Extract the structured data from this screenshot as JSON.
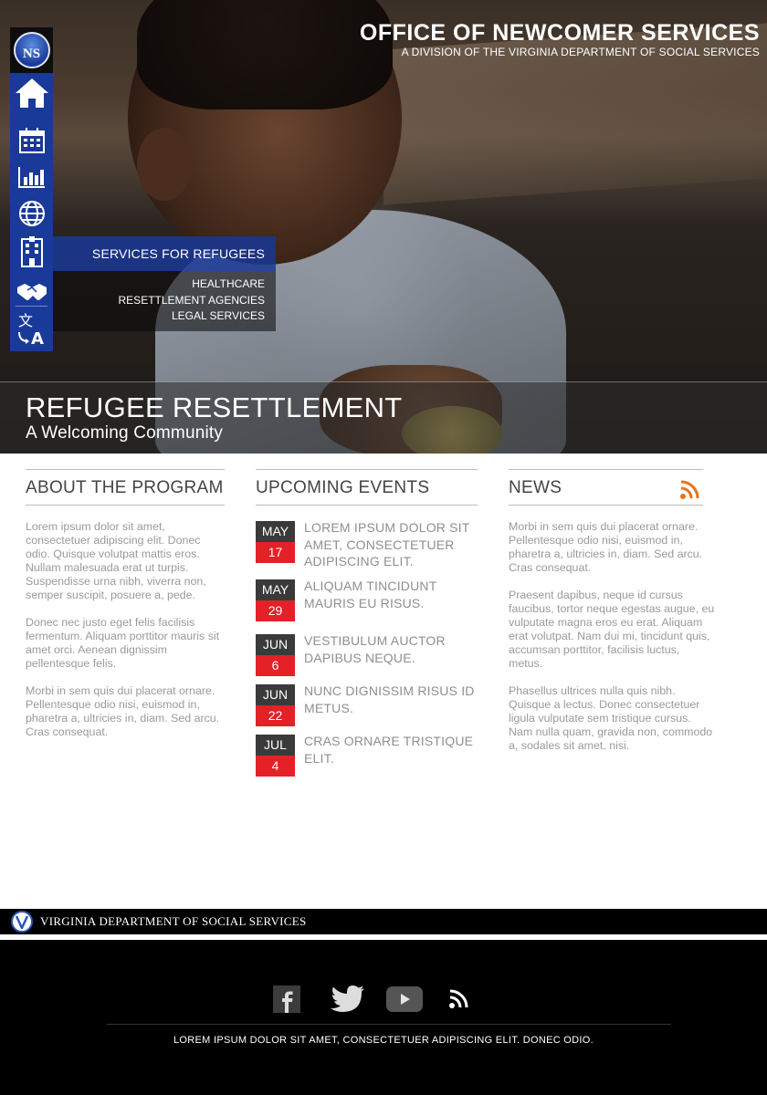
{
  "header": {
    "title": "OFFICE OF NEWCOMER SERVICES",
    "subtitle": "A DIVISION OF THE VIRGINIA DEPARTMENT OF  SOCIAL SERVICES"
  },
  "logo": {
    "text": "NS"
  },
  "sidenav": {
    "icons": [
      "home-icon",
      "calendar-icon",
      "bar-chart-icon",
      "globe-icon",
      "building-icon",
      "handshake-icon",
      "translate-icon"
    ]
  },
  "submenu": {
    "heading": "SERVICES FOR REFUGEES",
    "items": [
      "HEALTHCARE",
      "RESETTLEMENT AGENCIES",
      "LEGAL SERVICES"
    ]
  },
  "banner": {
    "title": "REFUGEE RESETTLEMENT",
    "subtitle": "A Welcoming Community"
  },
  "about": {
    "heading": "ABOUT THE PROGRAM",
    "paragraphs": [
      "Lorem ipsum dolor sit amet, consectetuer adipiscing elit. Donec odio. Quisque volutpat mattis eros. Nullam malesuada erat ut turpis. Suspendisse urna nibh, viverra non, semper suscipit, posuere a, pede.",
      "Donec nec justo eget felis facilisis fermentum. Aliquam porttitor mauris sit amet orci. Aenean dignissim pellentesque felis.",
      "Morbi in sem quis dui placerat ornare. Pellentesque odio nisi, euismod in, pharetra a, ultricies in, diam. Sed arcu. Cras consequat."
    ]
  },
  "events": {
    "heading": "UPCOMING EVENTS",
    "items": [
      {
        "month": "MAY",
        "day": "17",
        "title": "LOREM IPSUM DOLOR SIT AMET, CONSECTETUER ADIPISCING ELIT."
      },
      {
        "month": "MAY",
        "day": "29",
        "title": "ALIQUAM TINCIDUNT MAURIS EU RISUS."
      },
      {
        "month": "JUN",
        "day": "6",
        "title": "VESTIBULUM AUCTOR DAPIBUS NEQUE."
      },
      {
        "month": "JUN",
        "day": "22",
        "title": "NUNC DIGNISSIM RISUS ID METUS."
      },
      {
        "month": "JUL",
        "day": "4",
        "title": "CRAS ORNARE TRISTIQUE ELIT."
      }
    ]
  },
  "news": {
    "heading": "NEWS",
    "rss_icon": "rss-icon",
    "paragraphs": [
      "Morbi in sem quis dui placerat ornare. Pellentesque odio nisi, euismod in, pharetra a, ultricies in, diam. Sed arcu. Cras consequat.",
      "Praesent dapibus, neque id cursus faucibus, tortor neque egestas augue, eu vulputate magna eros eu erat. Aliquam erat volutpat. Nam dui mi, tincidunt quis, accumsan porttitor, facilisis luctus, metus.",
      "Phasellus ultrices nulla quis nibh. Quisque a lectus. Donec consectetuer ligula vulputate sem tristique cursus. Nam nulla quam, gravida non, commodo a, sodales sit amet, nisi."
    ]
  },
  "footer": {
    "agency": "VIRGINIA DEPARTMENT OF SOCIAL SERVICES",
    "social": [
      "facebook-icon",
      "twitter-icon",
      "youtube-icon",
      "rss-icon"
    ],
    "text": "LOREM IPSUM DOLOR SIT AMET, CONSECTETUER ADIPISCING ELIT. DONEC ODIO."
  },
  "colors": {
    "nav_blue": "#1a3a99",
    "event_red": "#e32126",
    "rss_orange": "#e8731c"
  }
}
